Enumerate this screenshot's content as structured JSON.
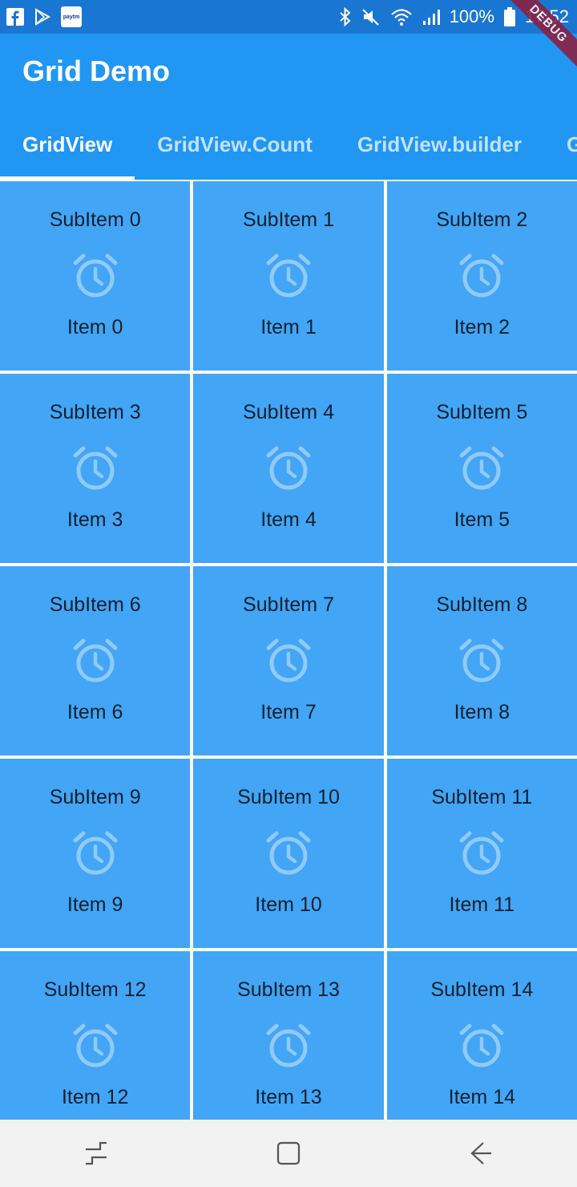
{
  "status_bar": {
    "battery": "100%",
    "time": "17:52",
    "left_icons": [
      "facebook-icon",
      "play-store-icon",
      "paytm-icon"
    ],
    "right_icons": [
      "bluetooth-icon",
      "mute-icon",
      "wifi-icon",
      "signal-icon",
      "battery-icon"
    ]
  },
  "debug_banner": "DEBUG",
  "app_bar": {
    "title": "Grid Demo",
    "tabs": [
      {
        "label": "GridView",
        "active": true
      },
      {
        "label": "GridView.Count",
        "active": false
      },
      {
        "label": "GridView.builder",
        "active": false
      },
      {
        "label": "Gr",
        "active": false
      }
    ]
  },
  "grid": {
    "icon": "alarm-icon",
    "tiles": [
      {
        "subitem": "SubItem 0",
        "item": "Item 0"
      },
      {
        "subitem": "SubItem 1",
        "item": "Item 1"
      },
      {
        "subitem": "SubItem 2",
        "item": "Item 2"
      },
      {
        "subitem": "SubItem 3",
        "item": "Item 3"
      },
      {
        "subitem": "SubItem 4",
        "item": "Item 4"
      },
      {
        "subitem": "SubItem 5",
        "item": "Item 5"
      },
      {
        "subitem": "SubItem 6",
        "item": "Item 6"
      },
      {
        "subitem": "SubItem 7",
        "item": "Item 7"
      },
      {
        "subitem": "SubItem 8",
        "item": "Item 8"
      },
      {
        "subitem": "SubItem 9",
        "item": "Item 9"
      },
      {
        "subitem": "SubItem 10",
        "item": "Item 10"
      },
      {
        "subitem": "SubItem 11",
        "item": "Item 11"
      },
      {
        "subitem": "SubItem 12",
        "item": "Item 12"
      },
      {
        "subitem": "SubItem 13",
        "item": "Item 13"
      },
      {
        "subitem": "SubItem 14",
        "item": "Item 14"
      }
    ]
  },
  "nav_bar": {
    "buttons": [
      "recent-apps-icon",
      "home-icon",
      "back-icon"
    ]
  },
  "colors": {
    "status_bar": "#1976D2",
    "app_bar": "#2196F3",
    "tile": "#42A5F5",
    "icon": "#90CAF9",
    "nav_bar": "#F2F2F2"
  }
}
